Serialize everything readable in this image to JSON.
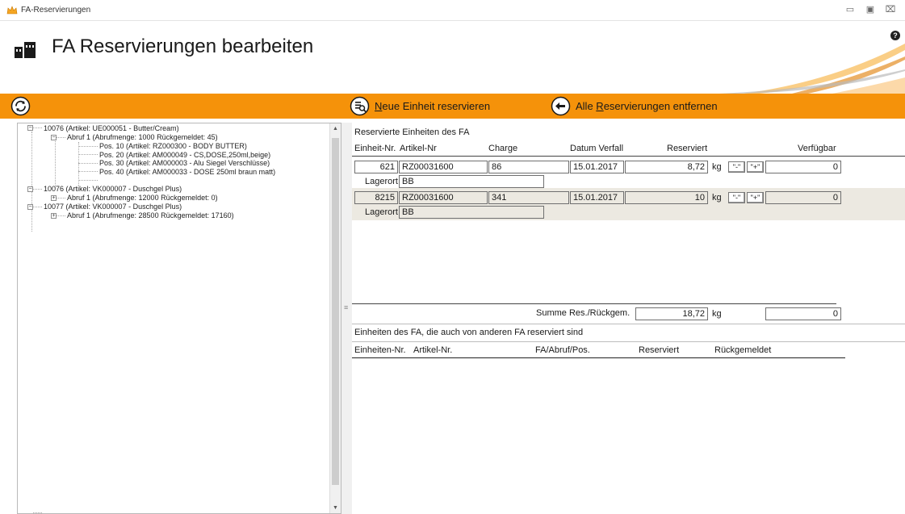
{
  "window": {
    "title": "FA-Reservierungen"
  },
  "header": {
    "title": "FA Reservierungen bearbeiten",
    "help_glyph": "?"
  },
  "toolbar": {
    "reserve_button": {
      "underline": "N",
      "rest": "eue Einheit reservieren"
    },
    "remove_button": {
      "prefix": "Alle ",
      "underline": "R",
      "rest": "eservierungen entfernen"
    }
  },
  "tree": {
    "nodes": [
      {
        "label": "10076 (Artikel: UE000051 - Butter/Cream)"
      },
      {
        "label": "Abruf 1 (Abrufmenge: 1000 Rückgemeldet: 45)"
      },
      {
        "label": "Pos. 10 (Artikel: RZ000300 - BODY BUTTER)"
      },
      {
        "label": "Pos. 20 (Artikel: AM000049 - CS,DOSE,250ml,beige)"
      },
      {
        "label": "Pos. 30 (Artikel: AM000003 - Alu Siegel Verschlüsse)"
      },
      {
        "label": "Pos. 40 (Artikel: AM000033 - DOSE 250ml braun matt)"
      },
      {
        "label": "10076 (Artikel: VK000007 - Duschgel Plus)"
      },
      {
        "label": "Abruf 1 (Abrufmenge: 12000 Rückgemeldet: 0)"
      },
      {
        "label": "10077 (Artikel: VK000007 - Duschgel Plus)"
      },
      {
        "label": "Abruf 1 (Abrufmenge: 28500 Rückgemeldet: 17160)"
      }
    ]
  },
  "reserved": {
    "section_title": "Reservierte Einheiten des FA",
    "columns": [
      "Einheit-Nr.",
      "Artikel-Nr",
      "Charge",
      "Datum Verfall",
      "Reserviert",
      "Verfügbar"
    ],
    "lagerort_label": "Lagerort",
    "unit_label": "kg",
    "minus_label": "\"-\"",
    "plus_label": "\"+\"",
    "rows": [
      {
        "einheit": "621",
        "artikel": "RZ00031600",
        "charge": "86",
        "verfall": "15.01.2017",
        "reserviert": "8,72",
        "verfuegbar": "0",
        "lagerort": "BB"
      },
      {
        "einheit": "8215",
        "artikel": "RZ00031600",
        "charge": "341",
        "verfall": "15.01.2017",
        "reserviert": "10",
        "verfuegbar": "0",
        "lagerort": "BB"
      }
    ],
    "sum_label": "Summe Res./Rückgem.",
    "sum_value": "18,72",
    "sum_unit": "kg",
    "sum_available": "0"
  },
  "others": {
    "section_title": "Einheiten des FA, die auch von anderen FA reserviert sind",
    "columns": [
      "Einheiten-Nr.",
      "Artikel-Nr.",
      "FA/Abruf/Pos.",
      "Reserviert",
      "Rückgemeldet"
    ]
  },
  "colors": {
    "accent": "#f5920a",
    "row_shaded": "#ece9e1"
  }
}
